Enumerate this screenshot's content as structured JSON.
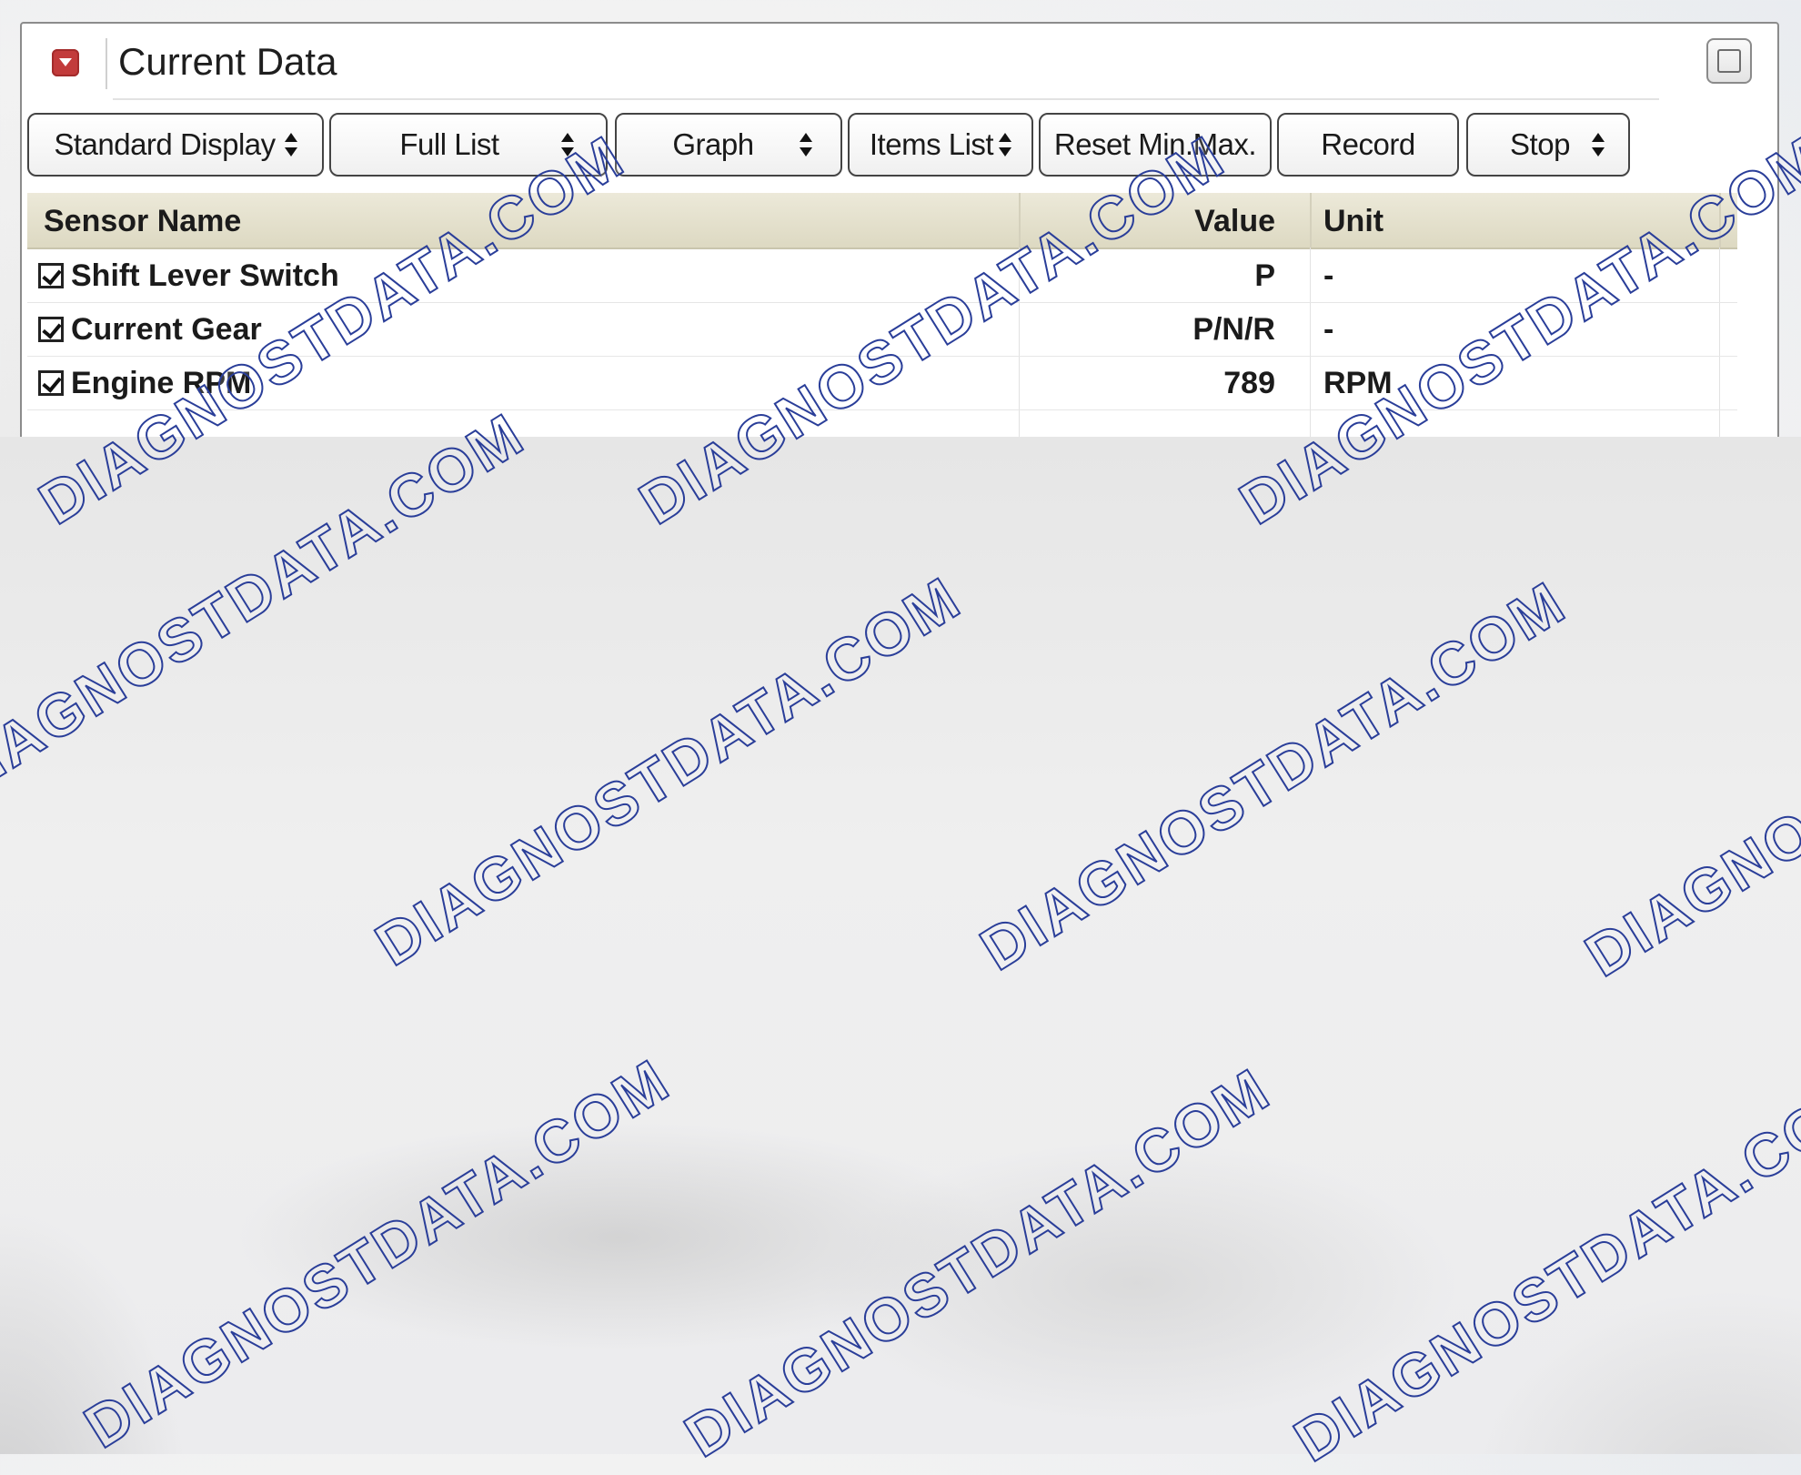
{
  "window": {
    "title": "Current Data"
  },
  "toolbar": {
    "standard_display": "Standard Display",
    "full_list": "Full List",
    "graph": "Graph",
    "items_list": "Items List",
    "reset_min_max": "Reset Min.Max.",
    "record": "Record",
    "stop": "Stop"
  },
  "table": {
    "headers": {
      "name": "Sensor Name",
      "value": "Value",
      "unit": "Unit"
    },
    "rows": [
      {
        "name": "Shift Lever Switch",
        "value": "P",
        "unit": "-"
      },
      {
        "name": "Current Gear",
        "value": "P/N/R",
        "unit": "-"
      },
      {
        "name": "Engine RPM",
        "value": "789",
        "unit": "RPM"
      }
    ]
  },
  "watermark": {
    "text": "DIAGNOSTDATA.COM"
  },
  "colors": {
    "header_bg": "#e4e0cc",
    "collapse_icon": "#c23b3b",
    "watermark_stroke": "#2a3e99"
  }
}
